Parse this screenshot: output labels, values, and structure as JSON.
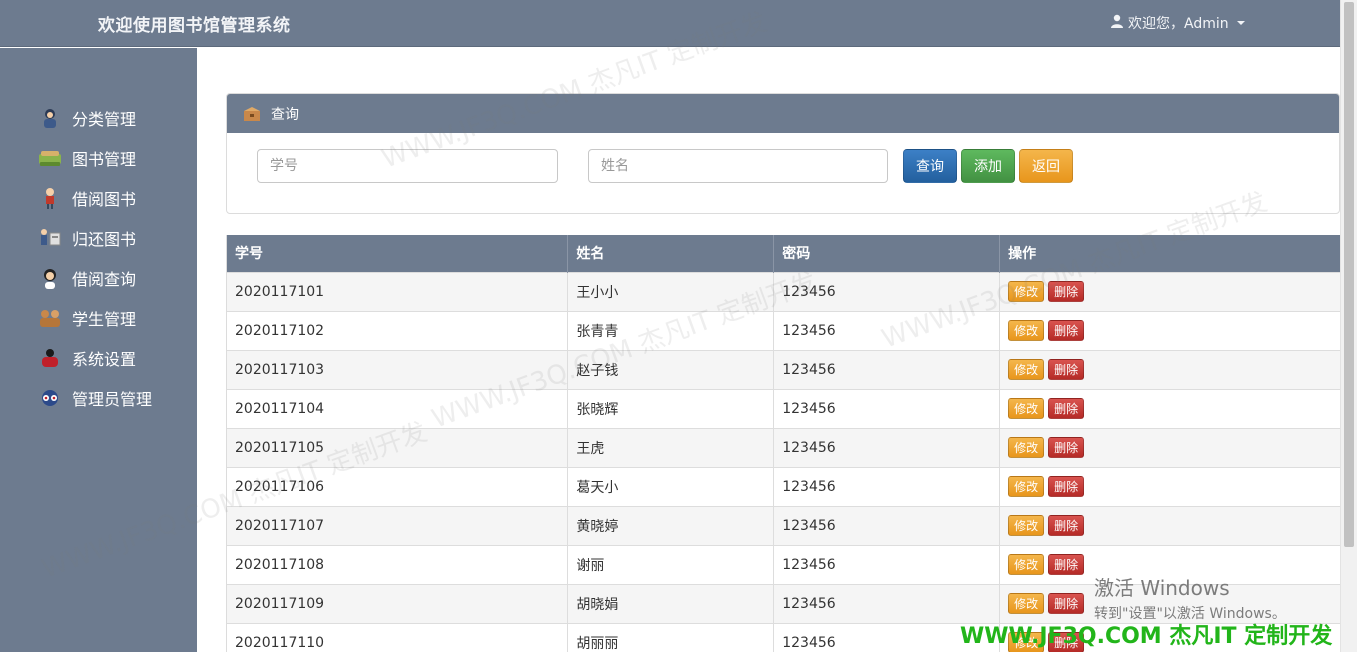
{
  "header": {
    "title": "欢迎使用图书馆管理系统",
    "user_label": "欢迎您，Admin",
    "user_icon": "person-icon"
  },
  "sidebar": {
    "items": [
      {
        "label": "分类管理",
        "icon": "category-icon"
      },
      {
        "label": "图书管理",
        "icon": "books-icon"
      },
      {
        "label": "借阅图书",
        "icon": "borrow-icon"
      },
      {
        "label": "归还图书",
        "icon": "return-icon"
      },
      {
        "label": "借阅查询",
        "icon": "query-icon"
      },
      {
        "label": "学生管理",
        "icon": "students-icon"
      },
      {
        "label": "系统设置",
        "icon": "settings-icon"
      },
      {
        "label": "管理员管理",
        "icon": "admin-icon"
      }
    ]
  },
  "search": {
    "panel_title": "查询",
    "student_id_placeholder": "学号",
    "name_placeholder": "姓名",
    "query_label": "查询",
    "add_label": "添加",
    "back_label": "返回"
  },
  "table": {
    "headers": [
      "学号",
      "姓名",
      "密码",
      "操作"
    ],
    "edit_label": "修改",
    "delete_label": "删除",
    "rows": [
      {
        "id": "2020117101",
        "name": "王小小",
        "password": "123456"
      },
      {
        "id": "2020117102",
        "name": "张青青",
        "password": "123456"
      },
      {
        "id": "2020117103",
        "name": "赵子钱",
        "password": "123456"
      },
      {
        "id": "2020117104",
        "name": "张晓辉",
        "password": "123456"
      },
      {
        "id": "2020117105",
        "name": "王虎",
        "password": "123456"
      },
      {
        "id": "2020117106",
        "name": "葛天小",
        "password": "123456"
      },
      {
        "id": "2020117107",
        "name": "黄晓婷",
        "password": "123456"
      },
      {
        "id": "2020117108",
        "name": "谢丽",
        "password": "123456"
      },
      {
        "id": "2020117109",
        "name": "胡晓娟",
        "password": "123456"
      },
      {
        "id": "2020117110",
        "name": "胡丽丽",
        "password": "123456"
      }
    ]
  },
  "overlay": {
    "activate_title": "激活 Windows",
    "activate_sub": "转到\"设置\"以激活 Windows。",
    "brand_text": "WWW.JF3Q.COM 杰凡IT  定制开发",
    "watermark": "WWW.JF3Q.COM 杰凡IT  定制开发"
  }
}
